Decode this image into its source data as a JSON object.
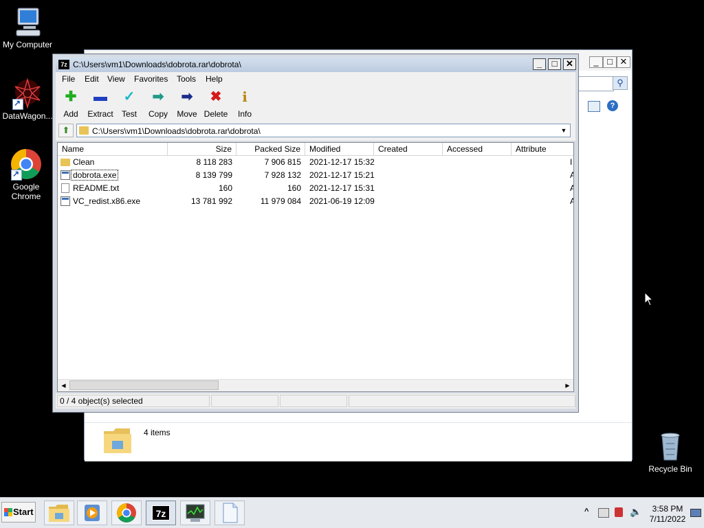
{
  "desktop": {
    "icons": [
      {
        "label": "My Computer"
      },
      {
        "label": "DataWagon..."
      },
      {
        "label": "Google Chrome"
      },
      {
        "label": "Recycle Bin"
      }
    ]
  },
  "explorer_bg": {
    "status_text": "4 items"
  },
  "zip_window": {
    "title": "C:\\Users\\vm1\\Downloads\\dobrota.rar\\dobrota\\",
    "app_icon": "7z",
    "controls": {
      "minimize": "_",
      "maximize": "□",
      "close": "✕"
    },
    "menu": [
      "File",
      "Edit",
      "View",
      "Favorites",
      "Tools",
      "Help"
    ],
    "toolbar": [
      {
        "label": "Add",
        "icon": "plus-icon",
        "glyph": "✚",
        "color": "#1fae1f"
      },
      {
        "label": "Extract",
        "icon": "minus-icon",
        "glyph": "▬",
        "color": "#1f3fbf"
      },
      {
        "label": "Test",
        "icon": "check-icon",
        "glyph": "✓",
        "color": "#19b6c9"
      },
      {
        "label": "Copy",
        "icon": "copy-arrow-icon",
        "glyph": "➡",
        "color": "#1f9a88"
      },
      {
        "label": "Move",
        "icon": "move-arrow-icon",
        "glyph": "➡",
        "color": "#1a2d8c"
      },
      {
        "label": "Delete",
        "icon": "delete-x-icon",
        "glyph": "✖",
        "color": "#d41a1a"
      },
      {
        "label": "Info",
        "icon": "info-icon",
        "glyph": "i",
        "color": "#b8860b"
      }
    ],
    "address": "C:\\Users\\vm1\\Downloads\\dobrota.rar\\dobrota\\",
    "columns": [
      "Name",
      "Size",
      "Packed Size",
      "Modified",
      "Created",
      "Accessed",
      "Attribute"
    ],
    "files": [
      {
        "name": "Clean",
        "type": "folder",
        "size": "8 118 283",
        "packed": "7 906 815",
        "modified": "2021-12-17 15:32",
        "created": "",
        "accessed": "",
        "attr": "I"
      },
      {
        "name": "dobrota.exe",
        "type": "exe",
        "size": "8 139 799",
        "packed": "7 928 132",
        "modified": "2021-12-17 15:21",
        "created": "",
        "accessed": "",
        "attr": "A"
      },
      {
        "name": "README.txt",
        "type": "txt",
        "size": "160",
        "packed": "160",
        "modified": "2021-12-17 15:31",
        "created": "",
        "accessed": "",
        "attr": "A"
      },
      {
        "name": "VC_redist.x86.exe",
        "type": "exe",
        "size": "13 781 992",
        "packed": "11 979 084",
        "modified": "2021-06-19 12:09",
        "created": "",
        "accessed": "",
        "attr": "A"
      }
    ],
    "status": "0 / 4 object(s) selected"
  },
  "taskbar": {
    "start_label": "Start",
    "apps": [
      {
        "icon": "file-explorer-icon"
      },
      {
        "icon": "media-player-icon"
      },
      {
        "icon": "chrome-icon"
      },
      {
        "icon": "7zip-icon",
        "label": "7z"
      },
      {
        "icon": "task-manager-icon"
      },
      {
        "icon": "blank-document-icon"
      }
    ],
    "tray_chevron": "^",
    "time": "3:58 PM",
    "date": "7/11/2022"
  }
}
